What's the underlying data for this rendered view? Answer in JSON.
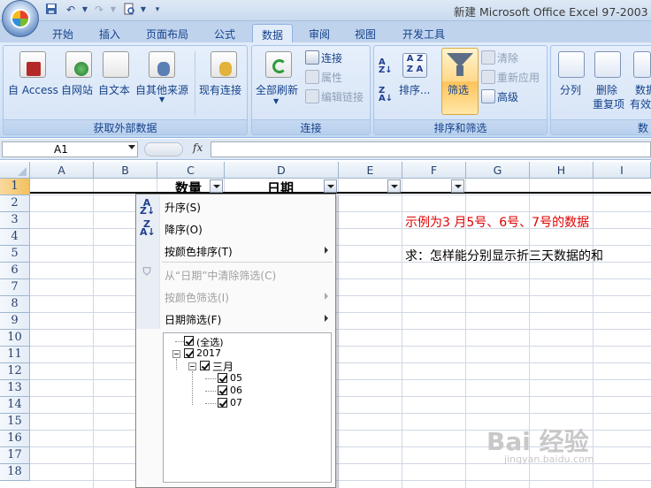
{
  "window": {
    "title": "新建 Microsoft Office Excel 97-2003 工"
  },
  "quick_access": {
    "icons": [
      "save-icon",
      "undo-icon",
      "redo-icon",
      "print-preview-icon",
      "customize-icon"
    ]
  },
  "tabs": [
    {
      "label": "开始"
    },
    {
      "label": "插入"
    },
    {
      "label": "页面布局"
    },
    {
      "label": "公式"
    },
    {
      "label": "数据",
      "active": true
    },
    {
      "label": "审阅"
    },
    {
      "label": "视图"
    },
    {
      "label": "开发工具"
    }
  ],
  "ribbon": {
    "get_external": {
      "label": "获取外部数据",
      "buttons": [
        "自 Access",
        "自网站",
        "自文本",
        "自其他来源",
        "现有连接"
      ]
    },
    "connections": {
      "label": "连接",
      "refresh_all": "全部刷新",
      "connections": "连接",
      "properties": "属性",
      "edit_links": "编辑链接"
    },
    "sort_filter": {
      "label": "排序和筛选",
      "sort": "排序...",
      "filter": "筛选",
      "clear": "清除",
      "reapply": "重新应用",
      "advanced": "高级"
    },
    "data_tools": {
      "label": "数",
      "text_to_columns": "分列",
      "remove_duplicates_1": "删除",
      "remove_duplicates_2": "重复项",
      "validation_1": "数据",
      "validation_2": "有效"
    }
  },
  "formula_bar": {
    "name_box": "A1",
    "fx": "fx",
    "value": ""
  },
  "grid": {
    "columns": [
      "A",
      "B",
      "C",
      "D",
      "E",
      "F",
      "G",
      "H",
      "I"
    ],
    "rows": [
      "1",
      "2",
      "3",
      "4",
      "5",
      "6",
      "7",
      "8",
      "9",
      "10",
      "11",
      "12",
      "13",
      "14",
      "15",
      "16",
      "17",
      "18"
    ],
    "header_cells": {
      "C1": "数量",
      "D1": "日期"
    },
    "notes": {
      "G3": "示例为3 月5号、6号、7号的数据",
      "G5": "求：怎样能分别显示折三天数据的和"
    },
    "colors": {
      "note_red": "#e00000",
      "note_black": "#000000"
    }
  },
  "filter_menu": {
    "sort_asc": "升序(S)",
    "sort_desc": "降序(O)",
    "sort_by_color": "按颜色排序(T)",
    "clear_filter": "从“日期”中清除筛选(C)",
    "filter_by_color": "按颜色筛选(I)",
    "date_filters": "日期筛选(F)",
    "tree": {
      "select_all": "(全选)",
      "year": "2017",
      "month": "三月",
      "days": [
        "05",
        "06",
        "07"
      ]
    }
  },
  "watermark": {
    "text": "Bai 经验",
    "sub": "jingyan.baidu.com"
  }
}
